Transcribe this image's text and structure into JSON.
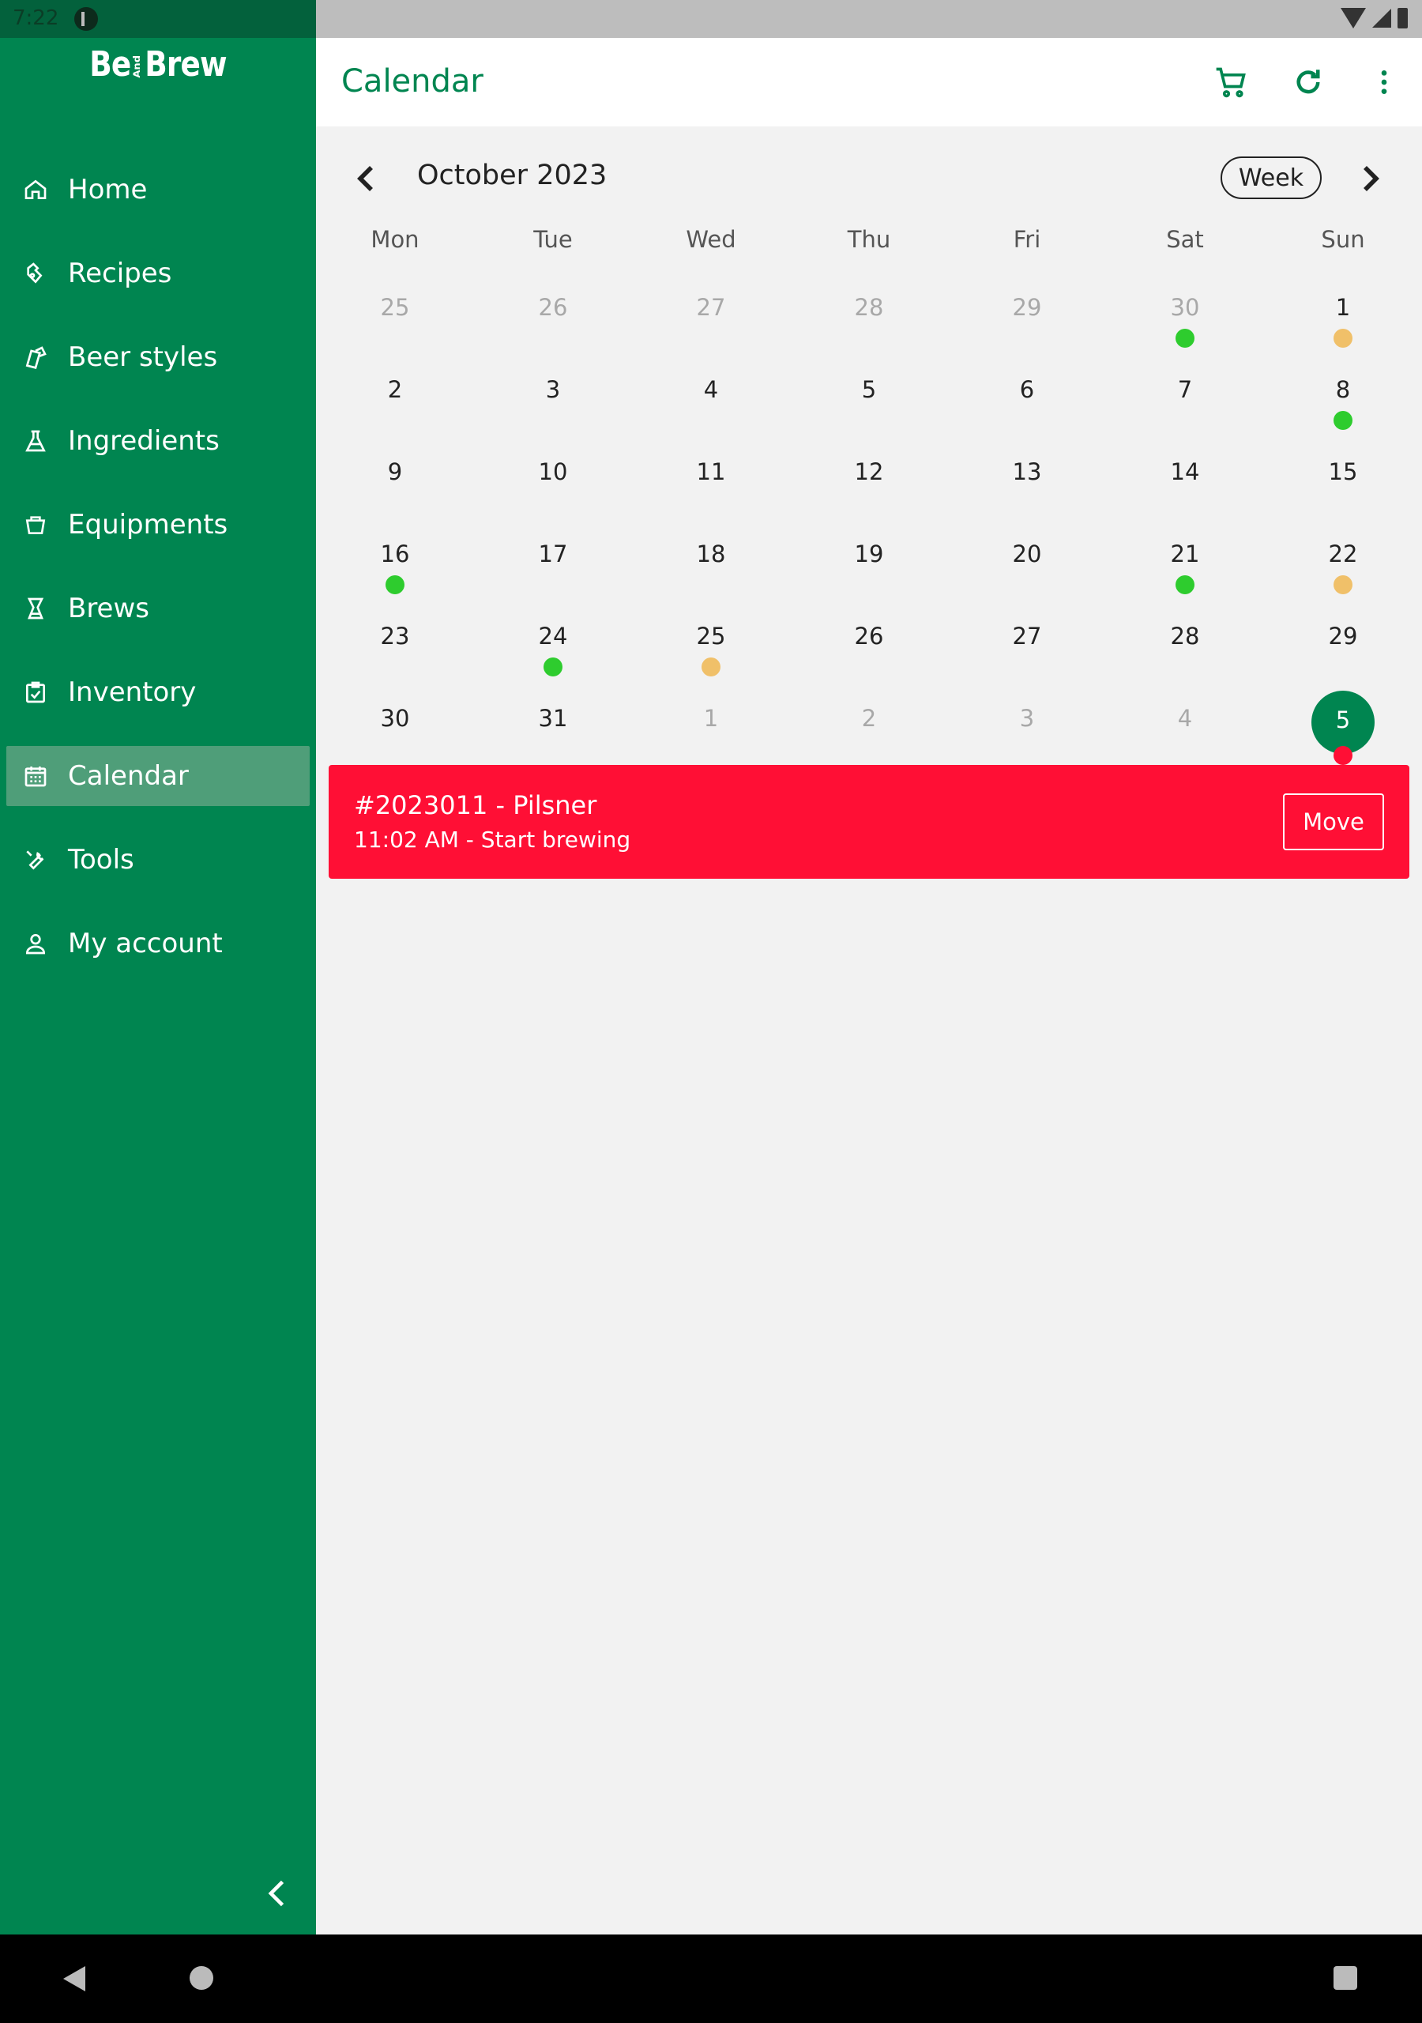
{
  "status_bar": {
    "time": "7:22"
  },
  "sidebar": {
    "logo": {
      "left": "Be",
      "mid": "And",
      "right": "Brew"
    },
    "items": [
      {
        "label": "Home",
        "icon": "home-icon"
      },
      {
        "label": "Recipes",
        "icon": "recipes-icon"
      },
      {
        "label": "Beer styles",
        "icon": "beer-styles-icon"
      },
      {
        "label": "Ingredients",
        "icon": "flask-icon"
      },
      {
        "label": "Equipments",
        "icon": "equipment-icon"
      },
      {
        "label": "Brews",
        "icon": "brews-icon"
      },
      {
        "label": "Inventory",
        "icon": "inventory-icon"
      },
      {
        "label": "Calendar",
        "icon": "calendar-icon",
        "active": true
      },
      {
        "label": "Tools",
        "icon": "wrench-icon"
      },
      {
        "label": "My account",
        "icon": "person-icon"
      }
    ]
  },
  "appbar": {
    "title": "Calendar"
  },
  "calendar": {
    "month_label": "October 2023",
    "view_button": "Week",
    "weekdays": [
      "Mon",
      "Tue",
      "Wed",
      "Thu",
      "Fri",
      "Sat",
      "Sun"
    ],
    "dot_colors": {
      "green": "#2ecc2e",
      "orange": "#f0c069",
      "red": "#ff0f35"
    },
    "weeks": [
      [
        {
          "d": "25",
          "out": true
        },
        {
          "d": "26",
          "out": true
        },
        {
          "d": "27",
          "out": true
        },
        {
          "d": "28",
          "out": true
        },
        {
          "d": "29",
          "out": true
        },
        {
          "d": "30",
          "out": true,
          "dot": "green"
        },
        {
          "d": "1",
          "dot": "orange"
        }
      ],
      [
        {
          "d": "2"
        },
        {
          "d": "3"
        },
        {
          "d": "4"
        },
        {
          "d": "5"
        },
        {
          "d": "6"
        },
        {
          "d": "7"
        },
        {
          "d": "8",
          "dot": "green"
        }
      ],
      [
        {
          "d": "9"
        },
        {
          "d": "10"
        },
        {
          "d": "11"
        },
        {
          "d": "12"
        },
        {
          "d": "13"
        },
        {
          "d": "14"
        },
        {
          "d": "15"
        }
      ],
      [
        {
          "d": "16",
          "dot": "green"
        },
        {
          "d": "17"
        },
        {
          "d": "18"
        },
        {
          "d": "19"
        },
        {
          "d": "20"
        },
        {
          "d": "21",
          "dot": "green"
        },
        {
          "d": "22",
          "dot": "orange"
        }
      ],
      [
        {
          "d": "23"
        },
        {
          "d": "24",
          "dot": "green"
        },
        {
          "d": "25",
          "dot": "orange"
        },
        {
          "d": "26"
        },
        {
          "d": "27"
        },
        {
          "d": "28"
        },
        {
          "d": "29"
        }
      ],
      [
        {
          "d": "30"
        },
        {
          "d": "31"
        },
        {
          "d": "1",
          "out": true
        },
        {
          "d": "2",
          "out": true
        },
        {
          "d": "3",
          "out": true
        },
        {
          "d": "4",
          "out": true
        },
        {
          "d": "5",
          "today": true,
          "dot": "red"
        }
      ]
    ]
  },
  "event": {
    "title": "#2023011 - Pilsner",
    "subtitle": "11:02 AM - Start brewing",
    "move_label": "Move",
    "color": "#ff0f35"
  },
  "colors": {
    "brand": "#008550",
    "sidebar_active": "#4f9e79"
  }
}
